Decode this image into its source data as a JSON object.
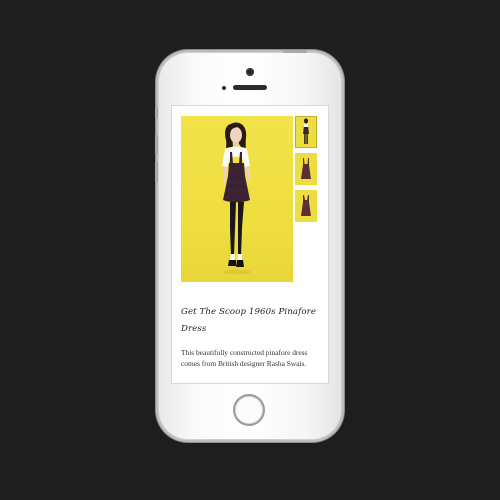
{
  "product": {
    "title": "Get The Scoop 1960s Pinafore Dress",
    "description": "This beautifully constructed pinafore dress comes from British designer Rasha Swais."
  },
  "gallery": {
    "main_image": "model-in-pinafore-dress-photo",
    "thumbnails": [
      "model-full-length-thumbnail",
      "dress-front-thumbnail",
      "dress-back-thumbnail"
    ],
    "background_color": "#eedd3e",
    "dress_color": "#3b2233"
  },
  "device": {
    "frame_color": "#f7f7f7",
    "backdrop_color": "#1e1e1e"
  }
}
